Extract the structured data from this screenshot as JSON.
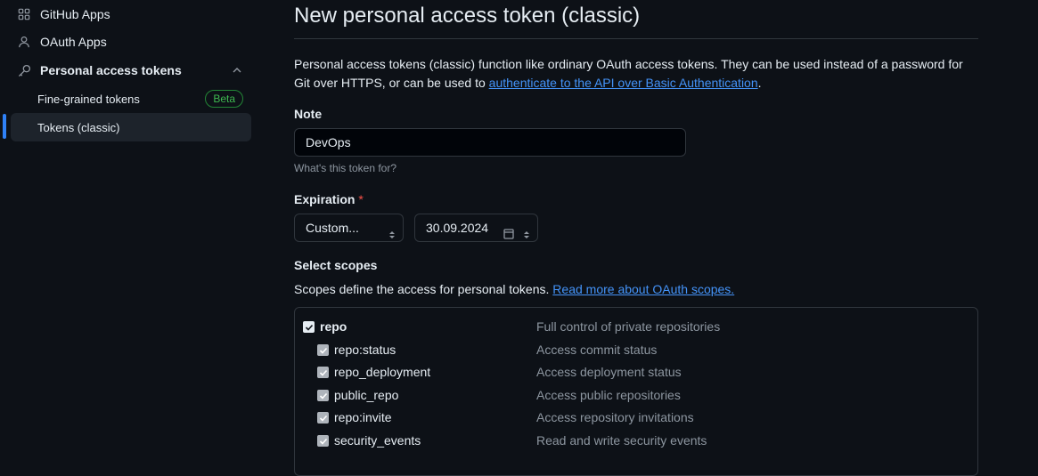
{
  "sidebar": {
    "items": [
      {
        "label": "GitHub Apps",
        "icon": "apps-grid-icon"
      },
      {
        "label": "OAuth Apps",
        "icon": "person-icon"
      },
      {
        "label": "Personal access tokens",
        "icon": "key-icon"
      }
    ],
    "sub_items": [
      {
        "label": "Fine-grained tokens",
        "badge": "Beta"
      },
      {
        "label": "Tokens (classic)",
        "active": true
      }
    ]
  },
  "page": {
    "title": "New personal access token (classic)",
    "description_prefix": "Personal access tokens (classic) function like ordinary OAuth access tokens. They can be used instead of a password for Git over HTTPS, or can be used to ",
    "description_link": "authenticate to the API over Basic Authentication",
    "description_suffix": "."
  },
  "note": {
    "label": "Note",
    "value": "DevOps",
    "hint": "What's this token for?"
  },
  "expiration": {
    "label": "Expiration",
    "required_mark": "*",
    "selected": "Custom...",
    "date": "30.09.2024"
  },
  "scopes": {
    "label": "Select scopes",
    "description": "Scopes define the access for personal tokens.",
    "link": "Read more about OAuth scopes.",
    "rows": [
      {
        "name": "repo",
        "desc": "Full control of private repositories",
        "level": 0,
        "checked": true
      },
      {
        "name": "repo:status",
        "desc": "Access commit status",
        "level": 1,
        "checked": true
      },
      {
        "name": "repo_deployment",
        "desc": "Access deployment status",
        "level": 1,
        "checked": true
      },
      {
        "name": "public_repo",
        "desc": "Access public repositories",
        "level": 1,
        "checked": true
      },
      {
        "name": "repo:invite",
        "desc": "Access repository invitations",
        "level": 1,
        "checked": true
      },
      {
        "name": "security_events",
        "desc": "Read and write security events",
        "level": 1,
        "checked": true
      }
    ]
  },
  "colors": {
    "background": "#0d1117",
    "accent": "#2f81f7",
    "link": "#4493f8",
    "badge_green": "#3fb950",
    "required_red": "#f85149"
  }
}
